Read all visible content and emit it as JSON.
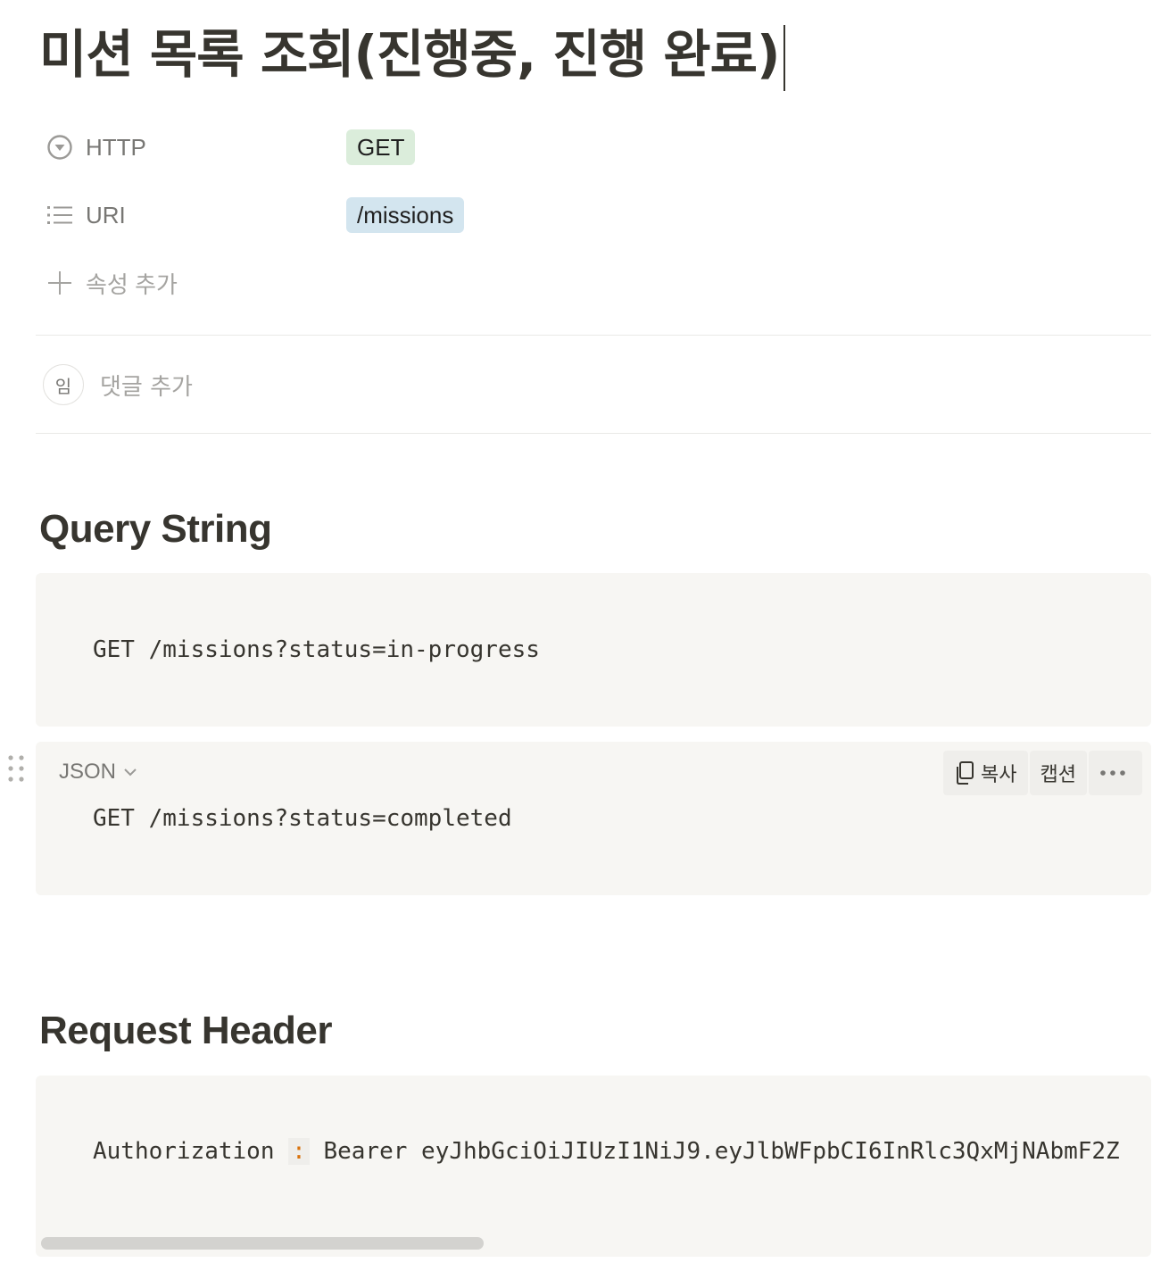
{
  "page": {
    "title": "미션 목록 조회(진행중, 진행 완료)"
  },
  "properties": [
    {
      "icon": "select-icon",
      "label": "HTTP",
      "value": "GET",
      "color": "#dbeddb"
    },
    {
      "icon": "list-icon",
      "label": "URI",
      "value": "/missions",
      "color": "#d3e5ef"
    }
  ],
  "add_property": {
    "label": "속성 추가"
  },
  "comment": {
    "avatar": "임",
    "placeholder": "댓글 추가"
  },
  "sections": {
    "query": {
      "heading": "Query String",
      "block1": "GET /missions?status=in-progress",
      "block2": "GET /missions?status=completed",
      "block2_language": "JSON",
      "toolbar": {
        "copy": "복사",
        "caption": "캡션",
        "more": "···"
      }
    },
    "header": {
      "heading": "Request Header",
      "key": "Authorization",
      "colon": ":",
      "value": "Bearer eyJhbGciOiJIUzI1NiJ9.eyJlbWFpbCI6InRlc3QxMjNAbmF2Z"
    }
  }
}
